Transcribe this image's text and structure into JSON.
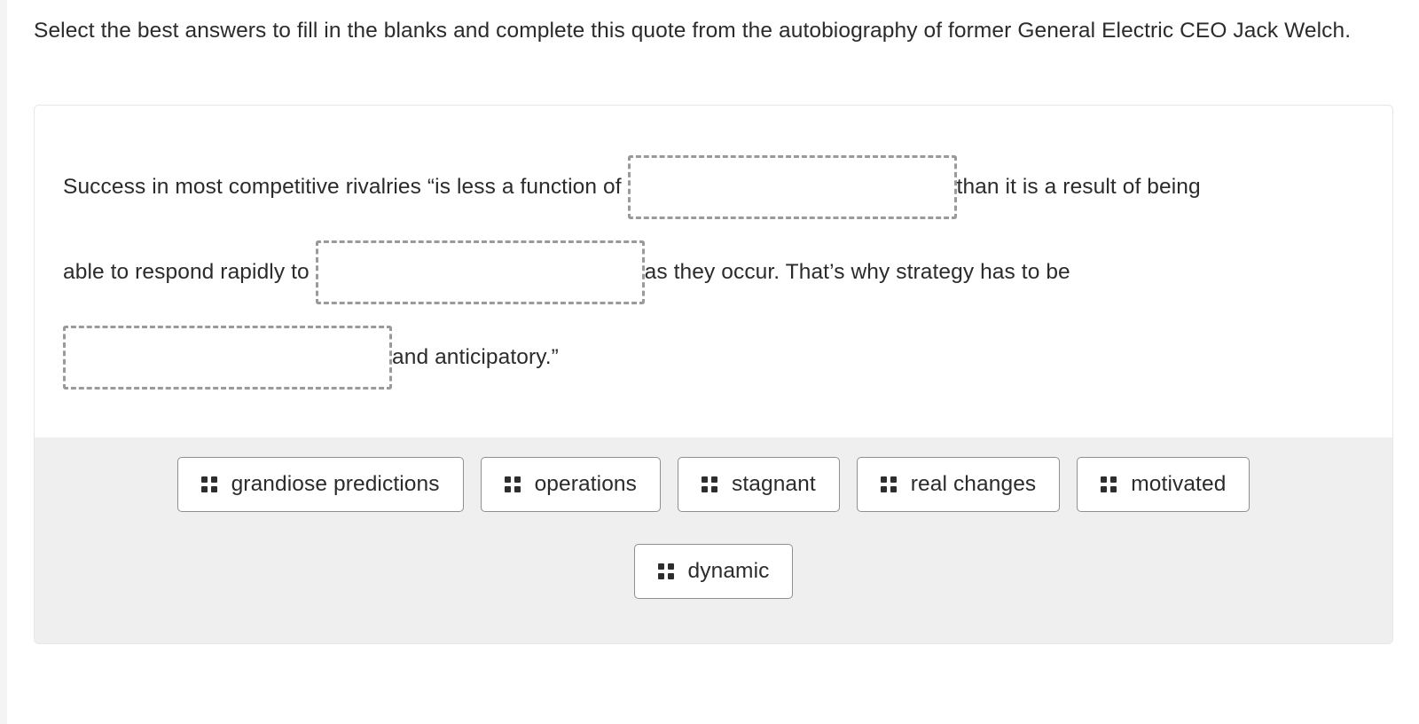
{
  "prompt": {
    "text": "Select the best answers to fill in the blanks and complete this quote from the autobiography of former General Electric CEO Jack Welch."
  },
  "quote": {
    "line1_pre": "Success in most competitive rivalries “is less a function of ",
    "blank1_value": "",
    "line1_post": "than it is a result of being",
    "line2_pre": "able to respond rapidly to ",
    "blank2_value": "",
    "line2_post": "as they occur. That’s why strategy has to be",
    "blank3_value": "",
    "line3_post": "and anticipatory.”"
  },
  "answer_bank": {
    "drag_handle_icon": "drag-handle-icon",
    "options": [
      {
        "label": "grandiose predictions"
      },
      {
        "label": "operations"
      },
      {
        "label": "stagnant"
      },
      {
        "label": "real changes"
      },
      {
        "label": "motivated"
      },
      {
        "label": "dynamic"
      }
    ]
  },
  "colors": {
    "page_background": "#ffffff",
    "card_border": "#e6e6e6",
    "bank_background": "#efefef",
    "blank_border": "#9a9a9a",
    "chip_border": "#8f8f8f",
    "text": "#2b2b2b"
  }
}
